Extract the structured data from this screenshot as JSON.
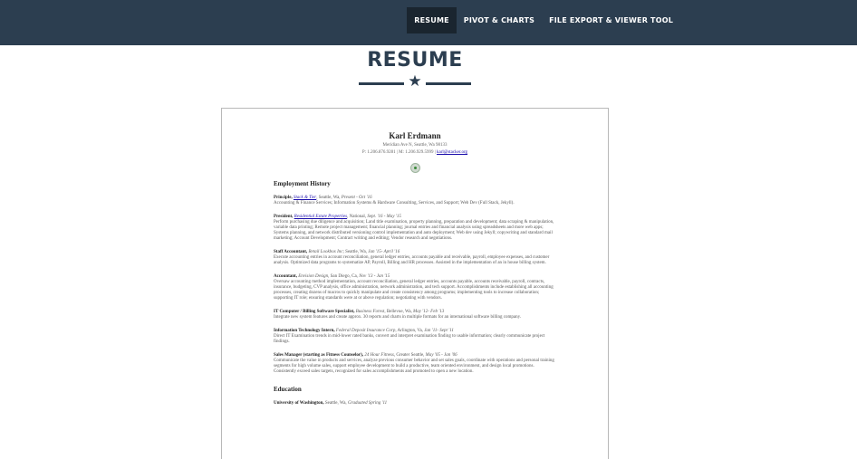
{
  "nav": {
    "items": [
      {
        "label": "RESUME",
        "active": true
      },
      {
        "label": "PIVOT & CHARTS",
        "active": false
      },
      {
        "label": "FILE EXPORT & VIEWER TOOL",
        "active": false
      }
    ]
  },
  "page": {
    "title": "RESUME",
    "divider_icon": "★"
  },
  "document": {
    "name": "Karl Erdmann",
    "address": "Meridian Ave N, Seattle, Wa 98133",
    "phone": "P: 1.206.876.9281",
    "separator": "|",
    "mobile": "M: 1.206.929.5999",
    "email": "karl@stacker.org",
    "icon": "globe-icon",
    "employment_heading": "Employment History",
    "jobs": [
      {
        "title": "Principle,",
        "company": "Stack & Tier",
        "company_linked": true,
        "meta": ", Seattle, Wa, ",
        "dates": "Present - Oct '16",
        "desc": "Accounting & Finance Services; Information Systems & Hardware Consulting, Services, and Support; Web Dev (Full Stack, Jekyll)."
      },
      {
        "title": "President,",
        "company": "Residential Estate Properties",
        "company_linked": true,
        "meta": ", National, ",
        "dates": "Sept. '16 - May '15",
        "desc": "Perform purchasing due diligence and acquisition; Land title examination, property planning, preparation and development; data scraping & manipulation, variable data printing; Remote project management; financial planning; journal entries and financial analysis using spreadsheets and more web apps; Systems planning, and network distributed versioning control implementation and auto deployment; Web dev using Jekyll; copywriting and standard mail marketing; Account Development; Contract writing and editing; Vendor research and negotiations."
      },
      {
        "title": "Staff Accountant,",
        "company": "Retail Lookbox Inc",
        "company_linked": false,
        "meta": "; Seattle, Wa, ",
        "dates": "Jan '15- April '16",
        "desc": "Execute accounting entries in account reconciliation, general ledger entries, accounts payable and receivable, payroll, employee expenses, and customer analysis. Optimized data programs to systematize AP, Payroll, Billing and HR processes. Assisted in the implementation of an in house billing system."
      },
      {
        "title": "Accountant,",
        "company": "Envision Design",
        "company_linked": false,
        "meta": ", San Diego, Ca, ",
        "dates": "Nov '13 - Jan '15",
        "desc": "Oversaw accounting method implementation, account reconciliation, general ledger entries, accounts payable, accounts receivable, payroll, contracts, insurance, budgeting, CVP analysis, office administration, network administration, and tech support. Accomplishments include establishing all accounting processes, creating dozens of macros to quickly manipulate and create consistency among programs; implementing tools to increase collaboration; supporting IT role; ensuring standards were at or above regulation; negotiating with vendors."
      },
      {
        "title": "IT Computer / Billing Software Specialist,",
        "company": "Business Forest",
        "company_linked": false,
        "meta": ", Bellevue, Wa, ",
        "dates": "May '12- Feb '13",
        "desc": "Integrate new system features and create approx. 30 reports and charts in multiple formats for an international software billing company."
      },
      {
        "title": "Information Technology Intern,",
        "company": "Federal Deposit Insurance Corp",
        "company_linked": false,
        "meta": ", Arlington, Va, ",
        "dates": "Jan '11- Sept '11",
        "desc": "Direct IT Examination trends in mid-lower rated banks, convert and interpret examination finding to usable information; clearly communicate project findings."
      },
      {
        "title": "Sales Manager (starting as Fitness Counselor),",
        "company": "24 Hour Fitness",
        "company_linked": false,
        "meta": ", Greater Seattle, ",
        "dates": "May '05 - Jan '06",
        "desc": "Communicate the value in products and services, analyze previous consumer behavior and set sales goals, coordinate with operations and personal training segments for high volume sales, support employee development to build a productive, team oriented environment, and design local promotions. Consistently exceed sales targets, recognized for sales accomplishments and promoted to open a new location."
      }
    ],
    "education_heading": "Education",
    "education": [
      {
        "school": "University of Washington,",
        "meta": " Seattle, Wa, ",
        "dates": "Graduated Spring '11"
      }
    ]
  },
  "colors": {
    "navbar_bg": "#2c3e50",
    "nav_active_bg": "#1a252f",
    "title": "#2c3e50",
    "link": "#1a0dab"
  }
}
